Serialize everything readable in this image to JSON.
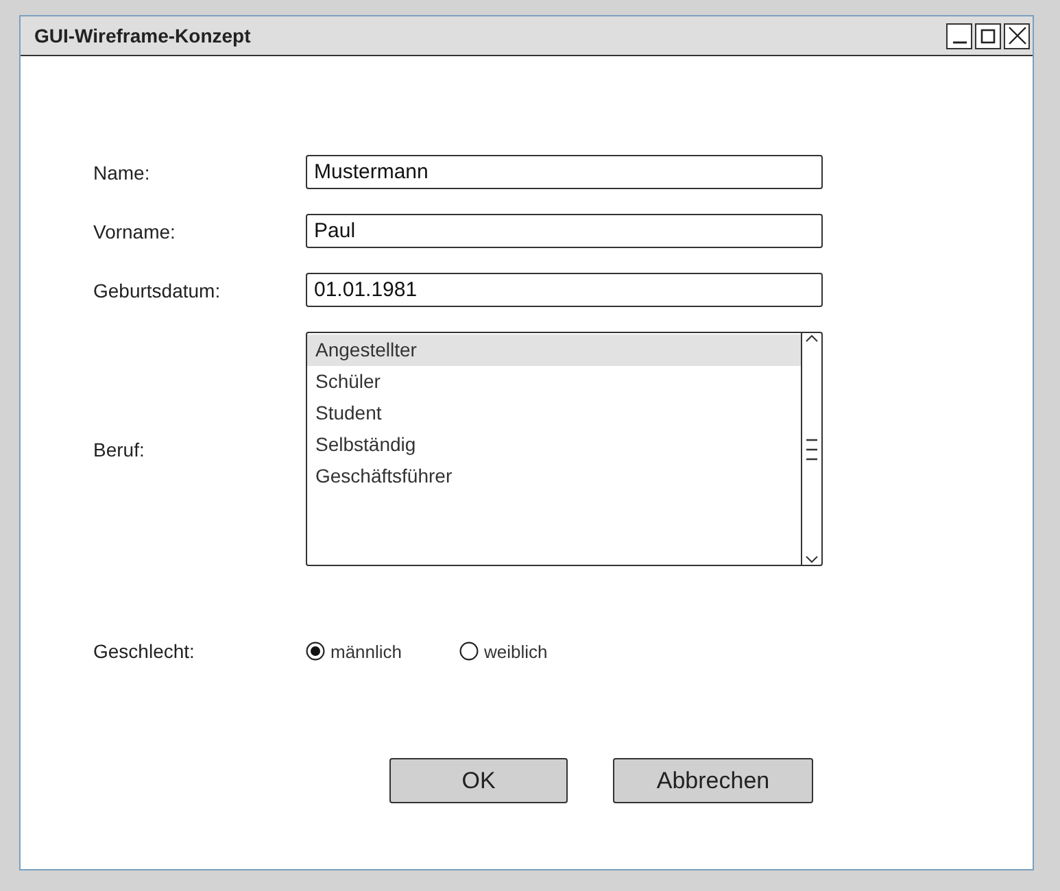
{
  "window": {
    "title": "GUI-Wireframe-Konzept"
  },
  "fields": [
    {
      "label": "Name:",
      "value": "Mustermann"
    },
    {
      "label": "Vorname:",
      "value": "Paul"
    },
    {
      "label": "Geburtsdatum:",
      "value": "01.01.1981"
    }
  ],
  "beruf": {
    "label": "Beruf:",
    "items": [
      {
        "text": "Angestellter",
        "selected": true
      },
      {
        "text": "Schüler",
        "selected": false
      },
      {
        "text": "Student",
        "selected": false
      },
      {
        "text": "Selbständig",
        "selected": false
      },
      {
        "text": "Geschäftsführer",
        "selected": false
      }
    ]
  },
  "geschlecht": {
    "label": "Geschlecht:",
    "options": [
      {
        "text": "männlich",
        "selected": true
      },
      {
        "text": "weiblich",
        "selected": false
      }
    ]
  },
  "buttons": [
    "OK",
    "Abbrechen"
  ]
}
